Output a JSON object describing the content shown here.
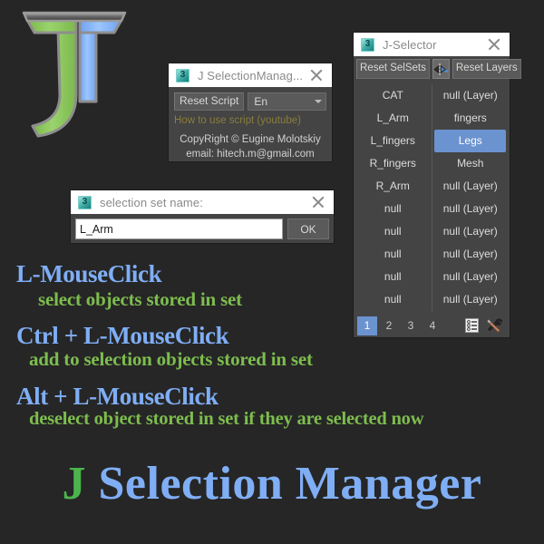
{
  "app": {
    "title_j": "J",
    "title_rest": " Selection Manager"
  },
  "logo": {
    "name": "jt-monogram-logo",
    "green": "#8CC75C",
    "blue": "#84B3FC",
    "outline": "#8a8a8a"
  },
  "colors": {
    "background": "#262626",
    "panel": "#444444",
    "titlebar": "#FFFFFF",
    "accent_blue": "#7FAEF5",
    "accent_green": "#7DBD4E",
    "highlight": "#6B93D0",
    "link": "#8A7D3C"
  },
  "selection_manager": {
    "title": "J SelectionManag...",
    "icon": "maxscript-3-icon",
    "close_label": "close-icon",
    "reset_script_label": "Reset Script",
    "language_value": "En",
    "language_options": [
      "En"
    ],
    "youtube_link": "How to use script (youtube)",
    "copyright_line1": "CopyRight © Eugine Molotskiy",
    "copyright_line2": "email: hitech.m@gmail.com"
  },
  "set_name_dialog": {
    "title": "selection set name:",
    "icon": "maxscript-3-icon",
    "input_value": "L_Arm",
    "input_placeholder": "",
    "ok_label": "OK"
  },
  "j_selector": {
    "title": "J-Selector",
    "icon": "maxscript-3-icon",
    "reset_selsets_label": "Reset SelSets",
    "mirror_button": "mirror-flip-icon",
    "reset_layers_label": "Reset Layers",
    "left_column": [
      "CAT",
      "L_Arm",
      "L_fingers",
      "R_fingers",
      "R_Arm",
      "null",
      "null",
      "null",
      "null",
      "null"
    ],
    "right_column": [
      "null (Layer)",
      "fingers",
      "Legs",
      "Mesh",
      "null (Layer)",
      "null (Layer)",
      "null (Layer)",
      "null (Layer)",
      "null (Layer)",
      "null (Layer)"
    ],
    "selected_right_index": 2,
    "tabs": [
      "1",
      "2",
      "3",
      "4"
    ],
    "active_tab": "1",
    "tab_icons": [
      "list-properties-icon",
      "tools-wrench-icon"
    ]
  },
  "instructions": [
    {
      "key": "L-MouseClick",
      "desc": "select objects stored in set"
    },
    {
      "key": "Ctrl + L-MouseClick",
      "desc": "add to selection objects stored in set"
    },
    {
      "key": "Alt + L-MouseClick",
      "desc": "deselect object stored in set if they are selected now"
    }
  ]
}
